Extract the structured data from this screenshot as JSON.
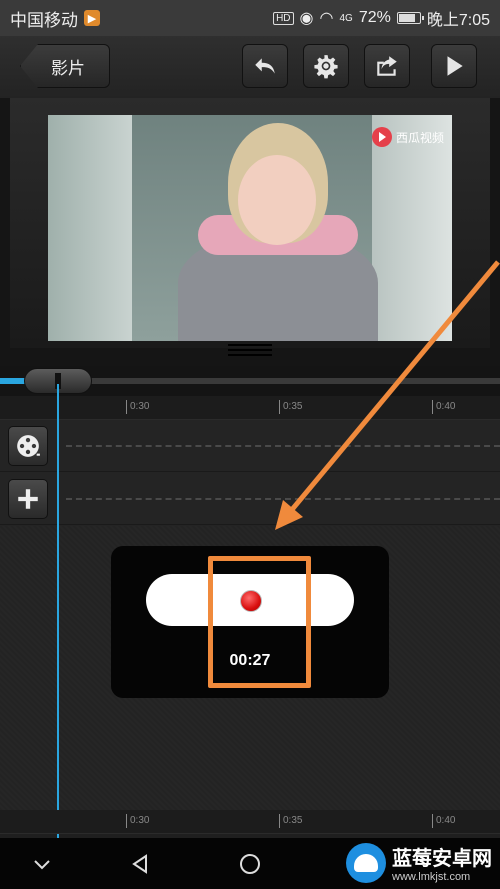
{
  "status_bar": {
    "carrier": "中国移动",
    "network": "4G",
    "battery": "72%",
    "time": "晚上7:05",
    "hd_label": "HD"
  },
  "toolbar": {
    "back_label": "影片",
    "buttons": [
      {
        "icon": "undo-icon"
      },
      {
        "icon": "gear-icon"
      },
      {
        "icon": "share-icon"
      },
      {
        "icon": "play-icon"
      }
    ]
  },
  "preview": {
    "watermark": "西瓜视频"
  },
  "timeline": {
    "ticks_top": [
      "0:30",
      "0:35",
      "0:40"
    ],
    "ticks_bottom": [
      "0:30",
      "0:35",
      "0:40"
    ]
  },
  "tracks": [
    {
      "icon": "film-reel-icon"
    },
    {
      "icon": "plus-icon"
    }
  ],
  "record": {
    "time": "00:27"
  },
  "brand": {
    "name": "蓝莓安卓网",
    "url": "www.lmkjst.com"
  },
  "colors": {
    "accent": "#2aa6e0",
    "highlight": "#f08a3c",
    "record": "#d90f0f"
  }
}
